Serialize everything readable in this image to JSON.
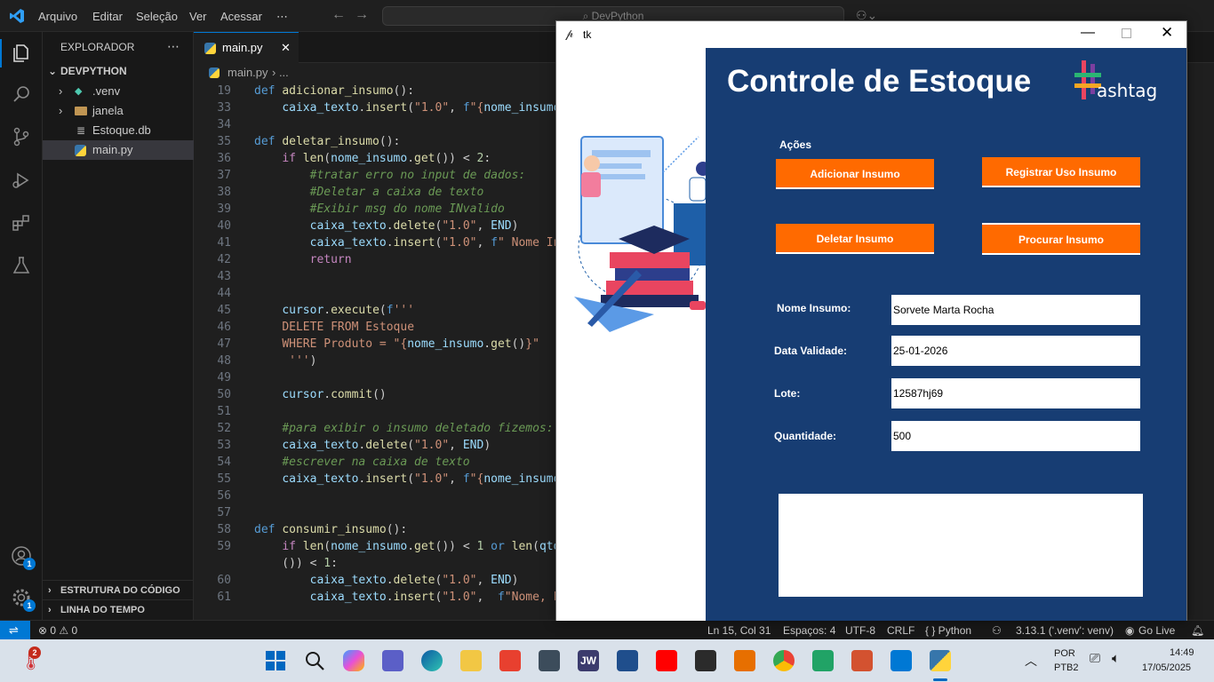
{
  "vscode": {
    "menu": [
      "Arquivo",
      "Editar",
      "Seleção",
      "Ver",
      "Acessar",
      "⋯"
    ],
    "search_placeholder": "DevPython",
    "explorer_title": "EXPLORADOR",
    "explorer_more": "⋯",
    "project": "DEVPYTHON",
    "tree": [
      ".venv",
      "janela",
      "Estoque.db",
      "main.py"
    ],
    "outline": "ESTRUTURA DO CÓDIGO",
    "timeline": "LINHA DO TEMPO",
    "account_badge": "1",
    "settings_badge": "1",
    "tab_label": "main.py",
    "tab_close": "✕",
    "breadcrumb_file": "main.py",
    "breadcrumb_sep": "› ...",
    "status": {
      "problems": "⊗ 0 ⚠ 0",
      "position": "Ln 15, Col 31",
      "spaces": "Espaços: 4",
      "encoding": "UTF-8",
      "eol": "CRLF",
      "language": "{ } Python",
      "interpreter": "3.13.1 ('.venv': venv)",
      "golive": "Go Live"
    }
  },
  "code_lines": [
    {
      "n": "19",
      "html": "<span class=\"kw\">def</span> <span class=\"fn\">adicionar_insumo</span>():"
    },
    {
      "n": "33",
      "html": "    <span class=\"var\">caixa_texto</span>.<span class=\"fn\">insert</span>(<span class=\"str\">\"1.0\"</span>, <span class=\"kw\">f</span><span class=\"str\">\"{</span><span class=\"var\">nome_insumo</span>"
    },
    {
      "n": "34",
      "html": ""
    },
    {
      "n": "35",
      "html": "<span class=\"kw\">def</span> <span class=\"fn\">deletar_insumo</span>():"
    },
    {
      "n": "36",
      "html": "    <span class=\"ctl\">if</span> <span class=\"fn\">len</span>(<span class=\"var\">nome_insumo</span>.<span class=\"fn\">get</span>()) &lt; <span class=\"num\">2</span>:"
    },
    {
      "n": "37",
      "html": "        <span class=\"cm\">#tratar erro no input de dados:</span>"
    },
    {
      "n": "38",
      "html": "        <span class=\"cm\">#Deletar a caixa de texto</span>"
    },
    {
      "n": "39",
      "html": "        <span class=\"cm\">#Exibir msg do nome INvalido</span>"
    },
    {
      "n": "40",
      "html": "        <span class=\"var\">caixa_texto</span>.<span class=\"fn\">delete</span>(<span class=\"str\">\"1.0\"</span>, <span class=\"var\">END</span>)"
    },
    {
      "n": "41",
      "html": "        <span class=\"var\">caixa_texto</span>.<span class=\"fn\">insert</span>(<span class=\"str\">\"1.0\"</span>, <span class=\"kw\">f</span><span class=\"str\">\" Nome In</span>"
    },
    {
      "n": "42",
      "html": "        <span class=\"ctl\">return</span>"
    },
    {
      "n": "43",
      "html": ""
    },
    {
      "n": "44",
      "html": ""
    },
    {
      "n": "45",
      "html": "    <span class=\"var\">cursor</span>.<span class=\"fn\">execute</span>(<span class=\"kw\">f</span><span class=\"str\">'''</span>"
    },
    {
      "n": "46",
      "html": "    <span class=\"sql\">DELETE FROM Estoque</span>"
    },
    {
      "n": "47",
      "html": "    <span class=\"sql\">WHERE Produto = \"{</span><span class=\"var\">nome_insumo</span>.<span class=\"fn\">get</span>()<span class=\"sql\">}\"</span>"
    },
    {
      "n": "48",
      "html": "     <span class=\"str\">'''</span>)"
    },
    {
      "n": "49",
      "html": ""
    },
    {
      "n": "50",
      "html": "    <span class=\"var\">cursor</span>.<span class=\"fn\">commit</span>()"
    },
    {
      "n": "51",
      "html": ""
    },
    {
      "n": "52",
      "html": "    <span class=\"cm\">#para exibir o insumo deletado fizemos:</span>"
    },
    {
      "n": "53",
      "html": "    <span class=\"var\">caixa_texto</span>.<span class=\"fn\">delete</span>(<span class=\"str\">\"1.0\"</span>, <span class=\"var\">END</span>)"
    },
    {
      "n": "54",
      "html": "    <span class=\"cm\">#escrever na caixa de texto</span>"
    },
    {
      "n": "55",
      "html": "    <span class=\"var\">caixa_texto</span>.<span class=\"fn\">insert</span>(<span class=\"str\">\"1.0\"</span>, <span class=\"kw\">f</span><span class=\"str\">\"{</span><span class=\"var\">nome_insumo</span>"
    },
    {
      "n": "56",
      "html": ""
    },
    {
      "n": "57",
      "html": ""
    },
    {
      "n": "58",
      "html": "<span class=\"kw\">def</span> <span class=\"fn\">consumir_insumo</span>():"
    },
    {
      "n": "59",
      "html": "    <span class=\"ctl\">if</span> <span class=\"fn\">len</span>(<span class=\"var\">nome_insumo</span>.<span class=\"fn\">get</span>()) &lt; <span class=\"num\">1</span> <span class=\"kw\">or</span> <span class=\"fn\">len</span>(<span class=\"var\">qtd</span>"
    },
    {
      "n": "",
      "html": "    ()) &lt; <span class=\"num\">1</span>:"
    },
    {
      "n": "60",
      "html": "        <span class=\"var\">caixa_texto</span>.<span class=\"fn\">delete</span>(<span class=\"str\">\"1.0\"</span>, <span class=\"var\">END</span>)"
    },
    {
      "n": "61",
      "html": "        <span class=\"var\">caixa_texto</span>.<span class=\"fn\">insert</span>(<span class=\"str\">\"1.0\"</span>,  <span class=\"kw\">f</span><span class=\"str\">\"Nome, L</span>"
    }
  ],
  "tk_window": {
    "title": "tk",
    "app_title": "Controle de Estoque",
    "logo_text": "ashtag",
    "actions_label": "Ações",
    "buttons": {
      "add": "Adicionar Insumo",
      "use": "Registrar Uso Insumo",
      "delete": "Deletar Insumo",
      "search": "Procurar Insumo"
    },
    "labels": {
      "name": "Nome Insumo:",
      "validity": "Data Validade:",
      "lot": "Lote:",
      "qty": "Quantidade:"
    },
    "values": {
      "name": "Sorvete Marta Rocha",
      "validity": "25-01-2026",
      "lot": "12587hj69",
      "qty": "500"
    }
  },
  "taskbar": {
    "weather_badge": "2",
    "lang": "POR",
    "layout": "PTB2",
    "time": "14:49",
    "date": "17/05/2025"
  },
  "colors": {
    "accent": "#0078d4",
    "tk_panel": "#173d73",
    "button": "#ff6a00"
  }
}
